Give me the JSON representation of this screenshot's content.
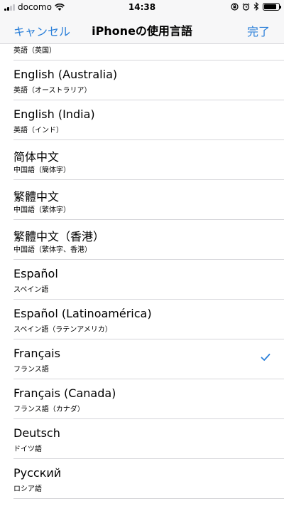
{
  "status_bar": {
    "carrier": "docomo",
    "time": "14:38",
    "battery_level": 0.85
  },
  "nav": {
    "cancel_label": "キャンセル",
    "title": "iPhoneの使用言語",
    "done_label": "完了"
  },
  "cut_item": {
    "sub": "英語（英国）"
  },
  "languages": [
    {
      "main": "English (Australia)",
      "sub": "英語（オーストラリア）"
    },
    {
      "main": "English (India)",
      "sub": "英語（インド）"
    },
    {
      "main": "简体中文",
      "sub": "中国語（簡体字）"
    },
    {
      "main": "繁體中文",
      "sub": "中国語（繁体字）"
    },
    {
      "main": "繁體中文（香港）",
      "sub": "中国語（繁体字、香港）"
    },
    {
      "main": "Español",
      "sub": "スペイン語"
    },
    {
      "main": "Español (Latinoamérica)",
      "sub": "スペイン語（ラテンアメリカ）"
    },
    {
      "main": "Français",
      "sub": "フランス語",
      "selected": true
    },
    {
      "main": "Français (Canada)",
      "sub": "フランス語（カナダ）"
    },
    {
      "main": "Deutsch",
      "sub": "ドイツ語"
    },
    {
      "main": "Русский",
      "sub": "ロシア語"
    }
  ],
  "colors": {
    "accent": "#2a7fd9",
    "separator": "#d6d6da",
    "bar_bg": "#f7f7f8"
  },
  "icons": {
    "status": [
      "signal-icon",
      "wifi-icon",
      "rotation-lock-icon",
      "alarm-icon",
      "bluetooth-icon",
      "battery-icon"
    ],
    "selected_marker": "checkmark-icon"
  }
}
